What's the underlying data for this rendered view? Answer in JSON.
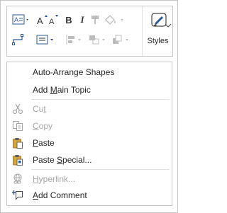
{
  "mini_toolbar": {
    "buttons": [
      {
        "name": "shape-style-icon"
      },
      {
        "name": "grow-font-icon"
      },
      {
        "name": "shrink-font-icon"
      },
      {
        "name": "bold-icon",
        "label": "B"
      },
      {
        "name": "italic-icon",
        "label": "I"
      },
      {
        "name": "format-painter-icon"
      },
      {
        "name": "fill-color-icon"
      },
      {
        "name": "connector-icon"
      },
      {
        "name": "align-text-icon"
      },
      {
        "name": "position-icon"
      },
      {
        "name": "group-icon"
      },
      {
        "name": "bring-to-front-icon"
      },
      {
        "name": "styles-icon"
      }
    ],
    "styles_label": "Styles"
  },
  "context_menu": {
    "items": [
      {
        "id": "auto-arrange",
        "pre": "Auto-Arrange Shapes",
        "u": "",
        "post": "",
        "disabled": false,
        "icon": null
      },
      {
        "id": "add-main-topic",
        "pre": "Add ",
        "u": "M",
        "post": "ain Topic",
        "disabled": false,
        "icon": null
      },
      {
        "id": "cut",
        "pre": "Cu",
        "u": "t",
        "post": "",
        "disabled": true,
        "icon": "scissors-icon"
      },
      {
        "id": "copy",
        "pre": "",
        "u": "C",
        "post": "opy",
        "disabled": true,
        "icon": "copy-icon"
      },
      {
        "id": "paste",
        "pre": "",
        "u": "P",
        "post": "aste",
        "disabled": false,
        "icon": "clipboard-icon"
      },
      {
        "id": "paste-special",
        "pre": "Paste ",
        "u": "S",
        "post": "pecial...",
        "disabled": false,
        "icon": "clipboard-special-icon"
      },
      {
        "id": "hyperlink",
        "pre": "",
        "u": "H",
        "post": "yperlink...",
        "disabled": true,
        "icon": "hyperlink-icon"
      },
      {
        "id": "add-comment",
        "pre": "",
        "u": "A",
        "post": "dd Comment",
        "disabled": false,
        "icon": "comment-icon"
      }
    ]
  },
  "colors": {
    "accent": "#2b579a",
    "disabled": "#a6a6a6",
    "border": "#c6c6c6",
    "clipboard": "#d6a73c"
  }
}
